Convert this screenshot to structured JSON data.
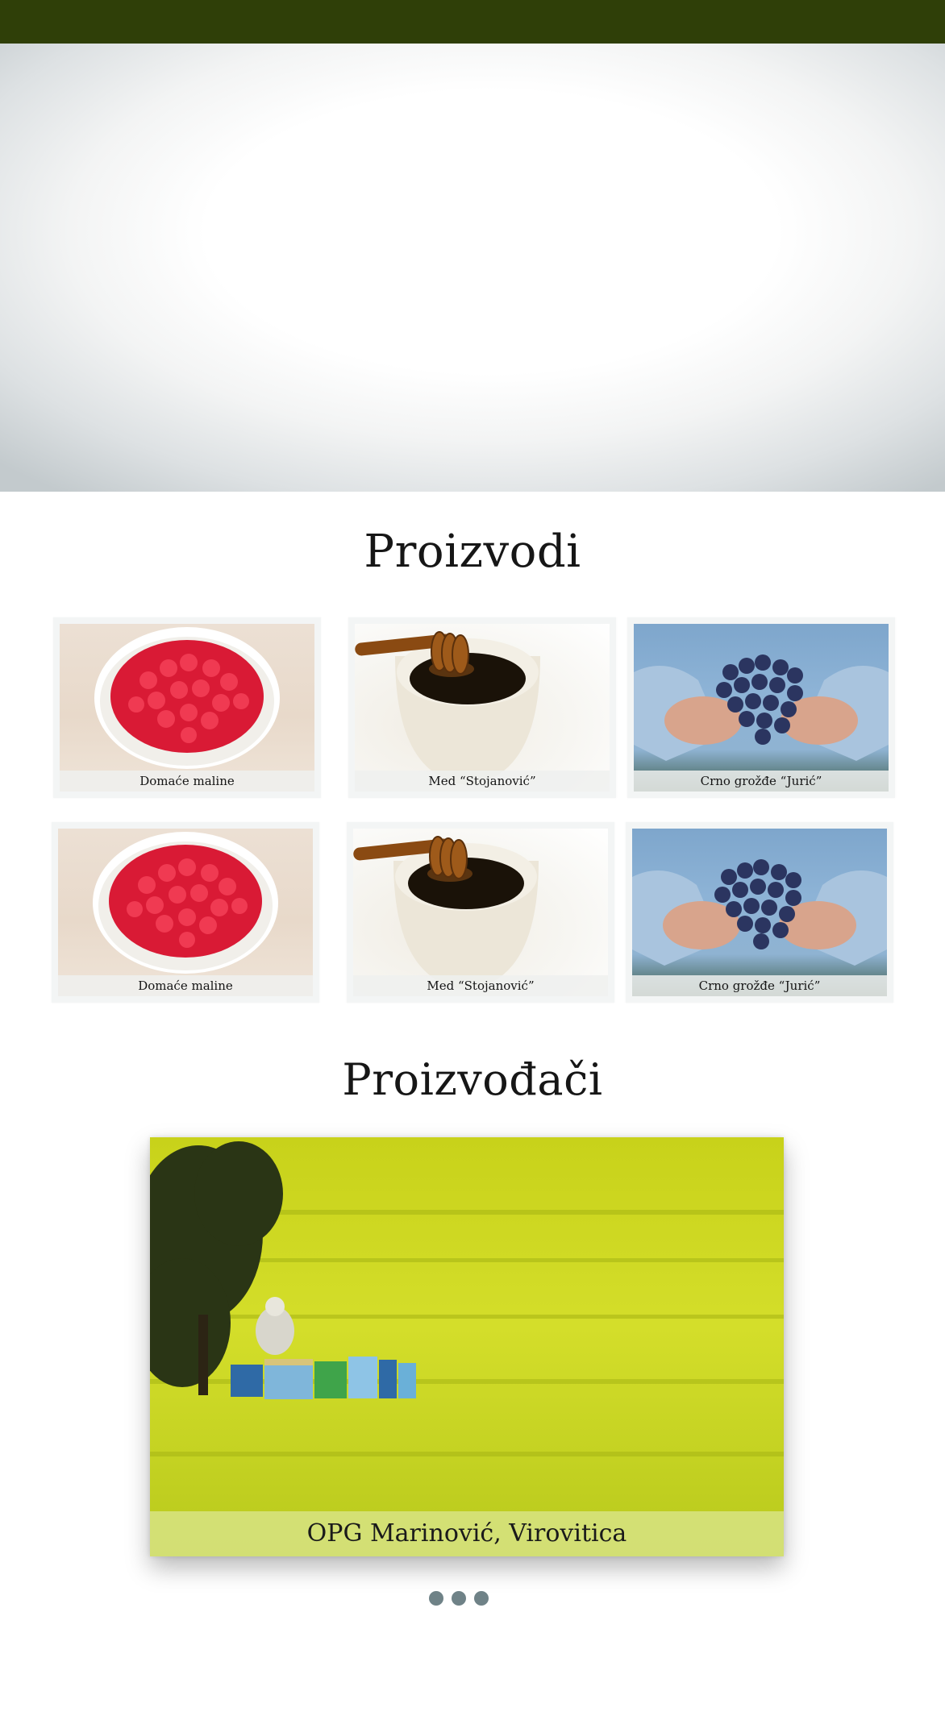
{
  "header": {
    "bar_color": "#2f3f08"
  },
  "products": {
    "title": "Proizvodi",
    "items": [
      {
        "caption": "Domaće maline",
        "image": "raspberries-photo"
      },
      {
        "caption": "Med “Stojanović”",
        "image": "honey-photo"
      },
      {
        "caption": "Crno grožđe “Jurić”",
        "image": "grapes-photo"
      },
      {
        "caption": "Domaće maline",
        "image": "raspberries-photo"
      },
      {
        "caption": "Med “Stojanović”",
        "image": "honey-photo"
      },
      {
        "caption": "Crno grožđe “Jurić”",
        "image": "grapes-photo"
      }
    ]
  },
  "producers": {
    "title": "Proizvođači",
    "slides": [
      {
        "caption": "OPG Marinović, Virovitica",
        "image": "rapeseed-field-beehives-photo"
      }
    ],
    "dot_count": 3,
    "dot_color": "#6f8287"
  }
}
